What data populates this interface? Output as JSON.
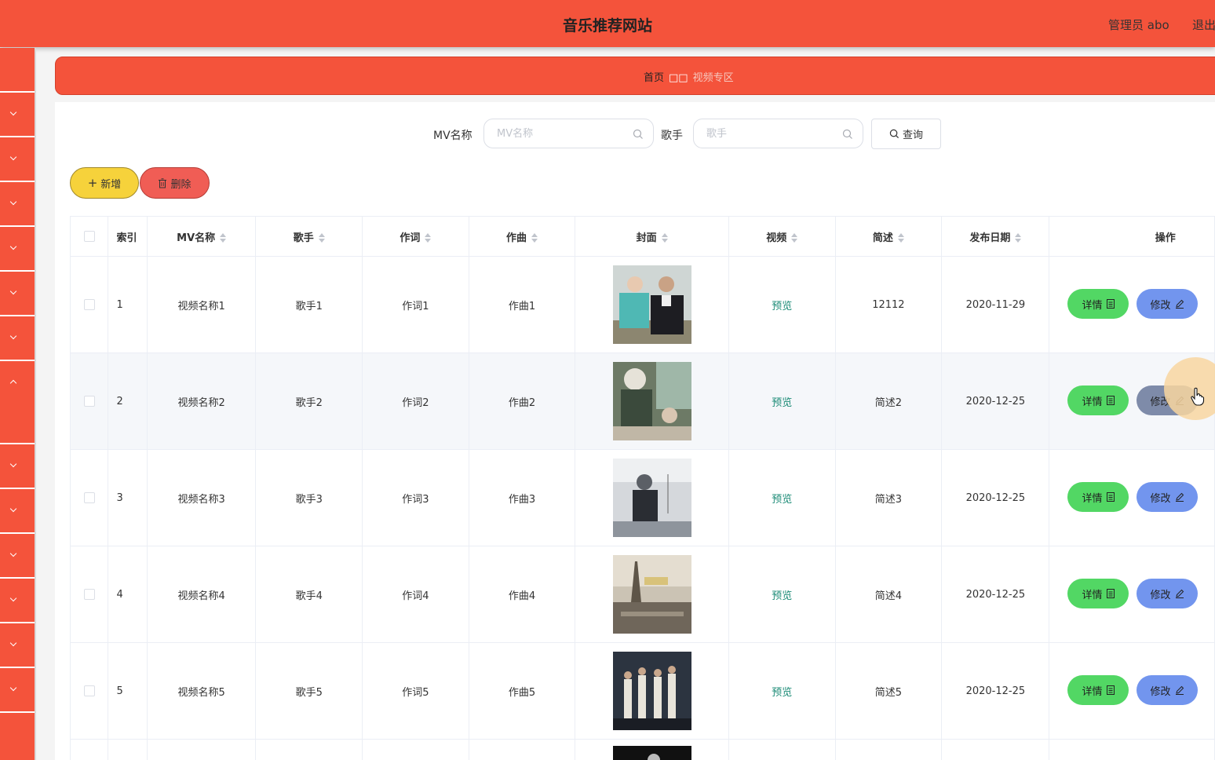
{
  "header": {
    "title": "音乐推荐网站",
    "admin": "管理员 abo",
    "logout": "退出"
  },
  "breadcrumb": {
    "home": "首页",
    "separator": "□□",
    "current": "视频专区"
  },
  "search": {
    "mv_label": "MV名称",
    "mv_placeholder": "MV名称",
    "mv_value": "",
    "singer_label": "歌手",
    "singer_placeholder": "歌手",
    "singer_value": "",
    "query_label": "查询"
  },
  "actions": {
    "add_label": "新增",
    "delete_label": "删除"
  },
  "table": {
    "columns": {
      "index": "索引",
      "name": "MV名称",
      "singer": "歌手",
      "lyricist": "作词",
      "composer": "作曲",
      "cover": "封面",
      "video": "视频",
      "desc": "简述",
      "date": "发布日期",
      "ops": "操作"
    },
    "rows": [
      {
        "index": "1",
        "name": "视频名称1",
        "singer": "歌手1",
        "lyricist": "作词1",
        "composer": "作曲1",
        "video": "预览",
        "desc": "12112",
        "date": "2020-11-29",
        "detail": "详情",
        "edit": "修改"
      },
      {
        "index": "2",
        "name": "视频名称2",
        "singer": "歌手2",
        "lyricist": "作词2",
        "composer": "作曲2",
        "video": "预览",
        "desc": "简述2",
        "date": "2020-12-25",
        "detail": "详情",
        "edit": "修改"
      },
      {
        "index": "3",
        "name": "视频名称3",
        "singer": "歌手3",
        "lyricist": "作词3",
        "composer": "作曲3",
        "video": "预览",
        "desc": "简述3",
        "date": "2020-12-25",
        "detail": "详情",
        "edit": "修改"
      },
      {
        "index": "4",
        "name": "视频名称4",
        "singer": "歌手4",
        "lyricist": "作词4",
        "composer": "作曲4",
        "video": "预览",
        "desc": "简述4",
        "date": "2020-12-25",
        "detail": "详情",
        "edit": "修改"
      },
      {
        "index": "5",
        "name": "视频名称5",
        "singer": "歌手5",
        "lyricist": "作词5",
        "composer": "作曲5",
        "video": "预览",
        "desc": "简述5",
        "date": "2020-12-25",
        "detail": "详情",
        "edit": "修改"
      }
    ]
  },
  "colors": {
    "brand": "#f4533b",
    "detail_button": "#52d764",
    "edit_button": "#7295ee",
    "add_button": "#f6d23b",
    "delete_button": "#f05d55",
    "preview_link": "#1b8b76"
  }
}
